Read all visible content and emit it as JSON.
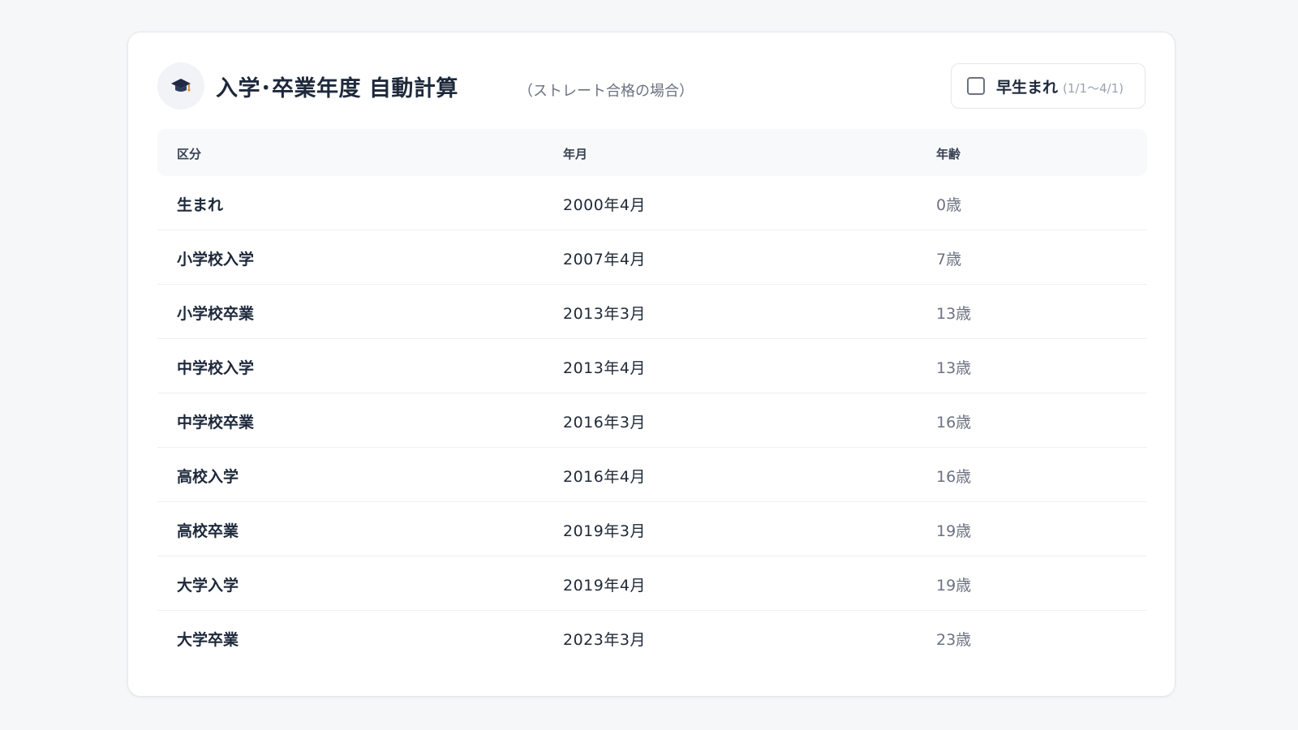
{
  "header": {
    "icon": "graduation-cap-icon",
    "title": "入学･卒業年度 自動計算",
    "subtitle": "（ストレート合格の場合）"
  },
  "toggle": {
    "label": "早生まれ",
    "hint": "(1/1〜4/1)",
    "checked": false
  },
  "table": {
    "headers": [
      "区分",
      "年月",
      "年齢"
    ],
    "rows": [
      {
        "category": "生まれ",
        "date": "2000年4月",
        "age": "0歳"
      },
      {
        "category": "小学校入学",
        "date": "2007年4月",
        "age": "7歳"
      },
      {
        "category": "小学校卒業",
        "date": "2013年3月",
        "age": "13歳"
      },
      {
        "category": "中学校入学",
        "date": "2013年4月",
        "age": "13歳"
      },
      {
        "category": "中学校卒業",
        "date": "2016年3月",
        "age": "16歳"
      },
      {
        "category": "高校入学",
        "date": "2016年4月",
        "age": "16歳"
      },
      {
        "category": "高校卒業",
        "date": "2019年3月",
        "age": "19歳"
      },
      {
        "category": "大学入学",
        "date": "2019年4月",
        "age": "19歳"
      },
      {
        "category": "大学卒業",
        "date": "2023年3月",
        "age": "23歳"
      }
    ]
  }
}
